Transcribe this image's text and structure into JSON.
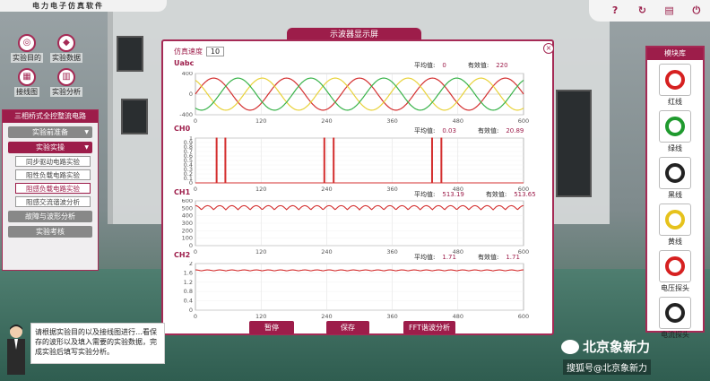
{
  "app": {
    "title": "电力电子仿真软件"
  },
  "top_icons": [
    "?",
    "↻",
    "▤",
    "⏻"
  ],
  "left_tools": [
    {
      "label": "实验目的",
      "icon": "goal-icon"
    },
    {
      "label": "实验数据",
      "icon": "data-icon"
    },
    {
      "label": "接线图",
      "icon": "wiring-icon"
    },
    {
      "label": "实验分析",
      "icon": "analysis-icon"
    }
  ],
  "experiment": {
    "title": "三相桥式全控整流电路",
    "prep": "实验前准备",
    "practice": "实验实操",
    "subs": [
      "同步驱动电路实验",
      "阻性负载电路实验",
      "阻感负载电路实验",
      "阻感交流谐波分析"
    ],
    "fault": "故障与波形分析",
    "exam": "实验考核"
  },
  "modules": {
    "title": "模块库",
    "items": [
      {
        "label": "红线",
        "color": "#d62020"
      },
      {
        "label": "绿线",
        "color": "#1f9a2e"
      },
      {
        "label": "黑线",
        "color": "#222222"
      },
      {
        "label": "黄线",
        "color": "#e6c21c"
      },
      {
        "label": "电压探头",
        "color": "#d62020"
      },
      {
        "label": "电流探头",
        "color": "#222222"
      }
    ]
  },
  "scope": {
    "title": "示波器显示屏",
    "speed_label": "仿真速度",
    "speed_value": "10",
    "avg_label": "平均值:",
    "eff_label": "有效值:",
    "buttons": {
      "pause": "暂停",
      "save": "保存",
      "fft": "FFT谐波分析"
    }
  },
  "guide": {
    "text": "请根据实验目的以及接线图进行…看保存的波形以及填入需要的实验数据，完成实验后填写实验分析。"
  },
  "watermark": {
    "brand": "北京象新力",
    "source": "搜狐号@北京象新力"
  },
  "chart_data": [
    {
      "type": "line",
      "title": "Uabc",
      "xlim": [
        0,
        600
      ],
      "ylim": [
        -400,
        400
      ],
      "yticks": [
        400,
        0,
        -400
      ],
      "xticks": [
        0,
        120,
        240,
        360,
        480,
        600
      ],
      "avg": "0",
      "rms": "220",
      "series": [
        {
          "color": "#d43030",
          "phase_deg": 0
        },
        {
          "color": "#e8d23a",
          "phase_deg": 120
        },
        {
          "color": "#39b34a",
          "phase_deg": 240
        }
      ],
      "amplitude": 311,
      "cycles": 4.5
    },
    {
      "type": "line",
      "title": "CH0",
      "xlim": [
        0,
        600
      ],
      "ylim": [
        0,
        1
      ],
      "yticks": [
        1,
        0.9,
        0.8,
        0.7,
        0.6,
        0.5,
        0.4,
        0.3,
        0.2,
        0.1,
        0
      ],
      "xticks": [
        0,
        120,
        240,
        360,
        480,
        600
      ],
      "avg": "0.03",
      "rms": "20.89",
      "pulses_x": [
        38,
        54,
        235,
        252,
        432,
        449
      ]
    },
    {
      "type": "line",
      "title": "CH1",
      "xlim": [
        0,
        600
      ],
      "ylim": [
        0,
        600
      ],
      "yticks": [
        600,
        500,
        400,
        300,
        200,
        100,
        0
      ],
      "xticks": [
        0,
        120,
        240,
        360,
        480,
        600
      ],
      "avg": "513.19",
      "rms": "513.65",
      "level": 513,
      "ripple": 55,
      "ripple_count": 27
    },
    {
      "type": "line",
      "title": "CH2",
      "xlim": [
        0,
        600
      ],
      "ylim": [
        0,
        2
      ],
      "yticks": [
        2,
        1.6,
        1.2,
        0.8,
        0.4,
        0
      ],
      "xticks": [
        0,
        120,
        240,
        360,
        480,
        600
      ],
      "avg": "1.71",
      "rms": "1.71",
      "level": 1.71,
      "ripple": 0.04,
      "ripple_count": 27
    }
  ]
}
